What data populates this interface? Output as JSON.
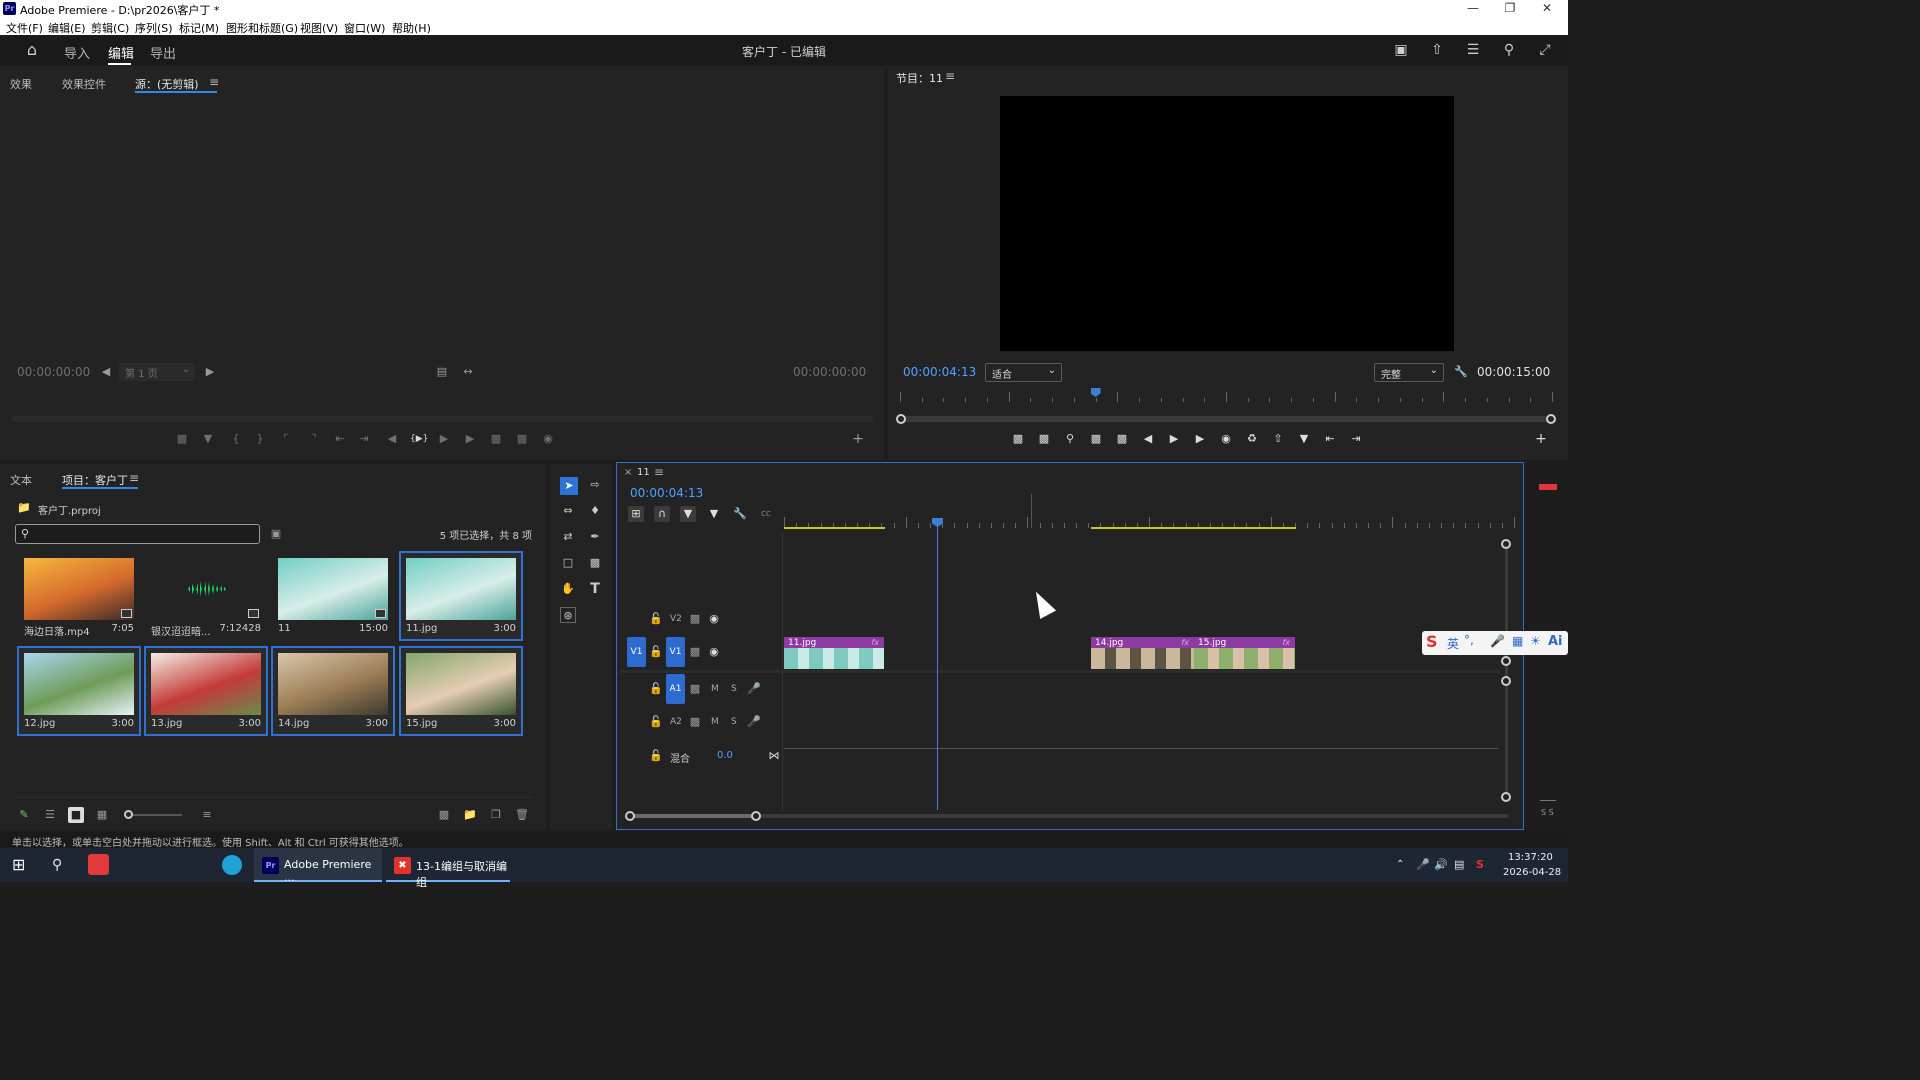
{
  "window": {
    "title": "Adobe Premiere - D:\\pr2026\\客户丁 *",
    "logo_text": "Pr"
  },
  "menubar": [
    "文件(F)",
    "编辑(E)",
    "剪辑(C)",
    "序列(S)",
    "标记(M)",
    "图形和标题(G)",
    "视图(V)",
    "窗口(W)",
    "帮助(H)"
  ],
  "header": {
    "nav": [
      "导入",
      "编辑",
      "导出"
    ],
    "active_nav": "编辑",
    "project_title": "客户丁 - 已编辑"
  },
  "source_panel": {
    "tabs": [
      "效果",
      "效果控件",
      "源：(无剪辑)"
    ],
    "active_tab": "源：(无剪辑)",
    "timecode_left": "00:00:00:00",
    "timecode_right": "00:00:00:00",
    "page_select": "第 1 页"
  },
  "program_panel": {
    "tab": "节目：11",
    "timecode_current": "00:00:04:13",
    "fit_select": "适合",
    "quality_select": "完整",
    "timecode_duration": "00:00:15:00",
    "playhead_fraction": 0.3
  },
  "project_panel": {
    "tabs": [
      "文本",
      "项目：客户丁"
    ],
    "active_tab": "项目：客户丁",
    "project_file": "客户丁.prproj",
    "selection_info": "5 项已选择，共 8 项",
    "search_placeholder": "",
    "items": [
      {
        "name": "海边日落.mp4",
        "duration": "7:05",
        "selected": false,
        "colors": [
          "#f7b73e",
          "#d46a2c",
          "#3a2a2a"
        ]
      },
      {
        "name": "银汉迢迢暗...",
        "duration": "7:12428",
        "selected": false,
        "colors": [
          "#232323",
          "#232323",
          "#232323"
        ]
      },
      {
        "name": "11",
        "duration": "15:00",
        "selected": false,
        "colors": [
          "#6fcfc3",
          "#d9ede9",
          "#4aa39a"
        ]
      },
      {
        "name": "11.jpg",
        "duration": "3:00",
        "selected": true,
        "colors": [
          "#6fcfc3",
          "#d9ede9",
          "#4aa39a"
        ]
      },
      {
        "name": "12.jpg",
        "duration": "3:00",
        "selected": true,
        "colors": [
          "#a9d6ee",
          "#6f9c58",
          "#e7f2f7"
        ]
      },
      {
        "name": "13.jpg",
        "duration": "3:00",
        "selected": true,
        "colors": [
          "#f4efe6",
          "#c43b38",
          "#6a8a4b"
        ]
      },
      {
        "name": "14.jpg",
        "duration": "3:00",
        "selected": true,
        "colors": [
          "#d8c7ac",
          "#9c7d54",
          "#3b3a30"
        ]
      },
      {
        "name": "15.jpg",
        "duration": "3:00",
        "selected": true,
        "colors": [
          "#84a66b",
          "#e6cdb4",
          "#36512c"
        ]
      }
    ]
  },
  "timeline": {
    "tab": "11",
    "timecode": "00:00:04:13",
    "tracks": {
      "V2": "V2",
      "V1": "V1",
      "V1_src": "V1",
      "A1": "A1",
      "A2": "A2",
      "mix_label": "混合",
      "mix_value": "0.0",
      "m": "M",
      "s": "S"
    },
    "clips": [
      {
        "label": "11.jpg",
        "fx": "fx"
      },
      {
        "label": "14.jpg",
        "fx": "fx"
      },
      {
        "label": "15.jpg",
        "fx": "fx"
      }
    ]
  },
  "meter": {
    "label": "S S"
  },
  "status_bar": "单击以选择，或单击空白处并拖动以进行框选。使用 Shift、Alt 和 Ctrl 可获得其他选项。",
  "ime": {
    "label": "英",
    "ai": "Ai"
  },
  "taskbar": {
    "apps": [
      "Adobe Premiere ...",
      "13-1编组与取消编组"
    ],
    "time": "13:37:20",
    "date": "2026-04-28"
  },
  "colors": {
    "accent_blue": "#2d8ceb",
    "timecode_blue": "#4fa3ff",
    "clip_purple": "#8e3aa3",
    "playhead": "#3d7fd8",
    "workarea_yellow": "#c8c821"
  }
}
